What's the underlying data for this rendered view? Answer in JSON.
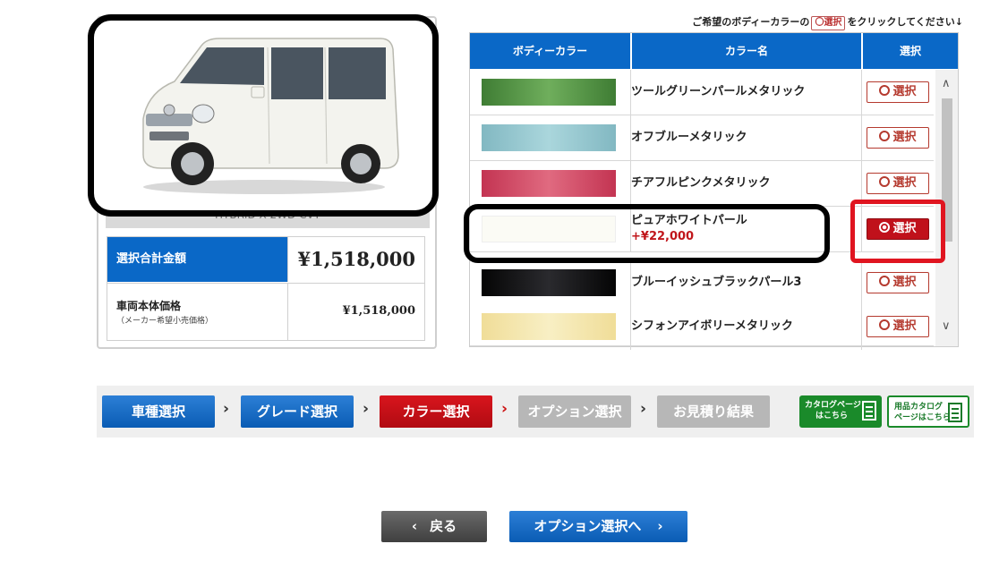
{
  "instruction": {
    "prefix": "ご希望のボディーカラーの",
    "button_label": "〇選択",
    "suffix": "をクリックしてください↓"
  },
  "car": {
    "grade_text": "HYBRID X 2WD CVT",
    "image_icon": "car-image-icon"
  },
  "price_table": {
    "total_label": "選択合計金額",
    "total_value": "¥1,518,000",
    "base_label": "車両本体価格",
    "base_sublabel": "（メーカー希望小売価格）",
    "base_value": "¥1,518,000"
  },
  "color_table": {
    "headers": [
      "ボディーカラー",
      "カラー名",
      "選択"
    ],
    "select_label": "選択",
    "rows": [
      {
        "name": "ツールグリーンパールメタリック",
        "price": "",
        "swatch": "#4a8a3c",
        "selected": false
      },
      {
        "name": "オフブルーメタリック",
        "price": "",
        "swatch": "#8fc3cc",
        "selected": false
      },
      {
        "name": "チアフルピンクメタリック",
        "price": "",
        "swatch": "#c9415a",
        "selected": false
      },
      {
        "name": "ピュアホワイトパール",
        "price": "+¥22,000",
        "swatch": "#fbfbf5",
        "selected": true
      },
      {
        "name": "ブルーイッシュブラックパール3",
        "price": "",
        "swatch": "#0e0e10",
        "selected": false
      },
      {
        "name": "シフォンアイボリーメタリック",
        "price": "",
        "swatch": "#f4e6a8",
        "selected": false
      }
    ]
  },
  "steps": [
    {
      "label": "車種選択",
      "state": "done"
    },
    {
      "label": "グレード選択",
      "state": "done"
    },
    {
      "label": "カラー選択",
      "state": "current"
    },
    {
      "label": "オプション選択",
      "state": "todo"
    },
    {
      "label": "お見積り結果",
      "state": "todo"
    }
  ],
  "catalogs": {
    "catalog_line1": "カタログページ",
    "catalog_line2": "はこちら",
    "accessory_line1": "用品カタログ",
    "accessory_line2": "ページはこちら"
  },
  "nav": {
    "back_label": "戻る",
    "next_label": "オプション選択へ"
  },
  "colors": {
    "primary_blue": "#0a68c7",
    "active_red": "#c0111b",
    "highlight_red": "#e01520",
    "catalog_green": "#1a8a2a"
  }
}
